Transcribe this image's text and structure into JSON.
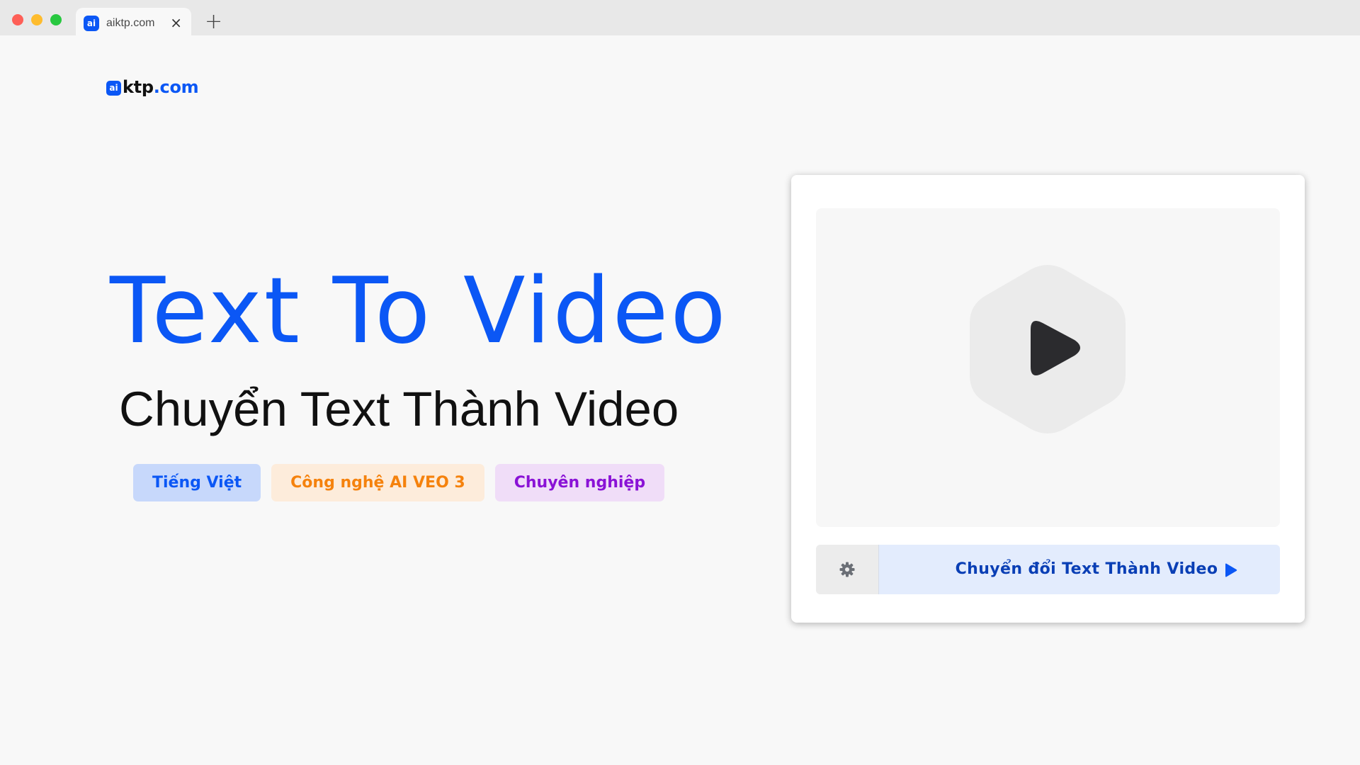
{
  "browser": {
    "tab_favicon": "ai",
    "tab_title": "aiktp.com",
    "tab_close": "×",
    "new_tab": "+"
  },
  "logo": {
    "mark": "ai",
    "text_dark": "ktp",
    "text_blue": ".com"
  },
  "hero": {
    "title": "Text To Video",
    "subtitle": "Chuyển Text Thành Video",
    "badges": [
      {
        "label": "Tiếng Việt",
        "color": "#0b57f5",
        "bg": "#c7d8fb"
      },
      {
        "label": "Công nghệ AI VEO 3",
        "color": "#f5820d",
        "bg": "#fdecdb"
      },
      {
        "label": "Chuyên nghiệp",
        "color": "#8a12d6",
        "bg": "#f0ddf8"
      }
    ]
  },
  "card": {
    "preview_icon": "play-icon",
    "settings_icon": "gear-icon",
    "convert_label": "Chuyển đổi Text Thành Video",
    "convert_icon": "play-icon"
  },
  "colors": {
    "brand": "#0b57f5",
    "page_bg": "#f8f8f8",
    "chrome_bg": "#e8e8e8"
  }
}
